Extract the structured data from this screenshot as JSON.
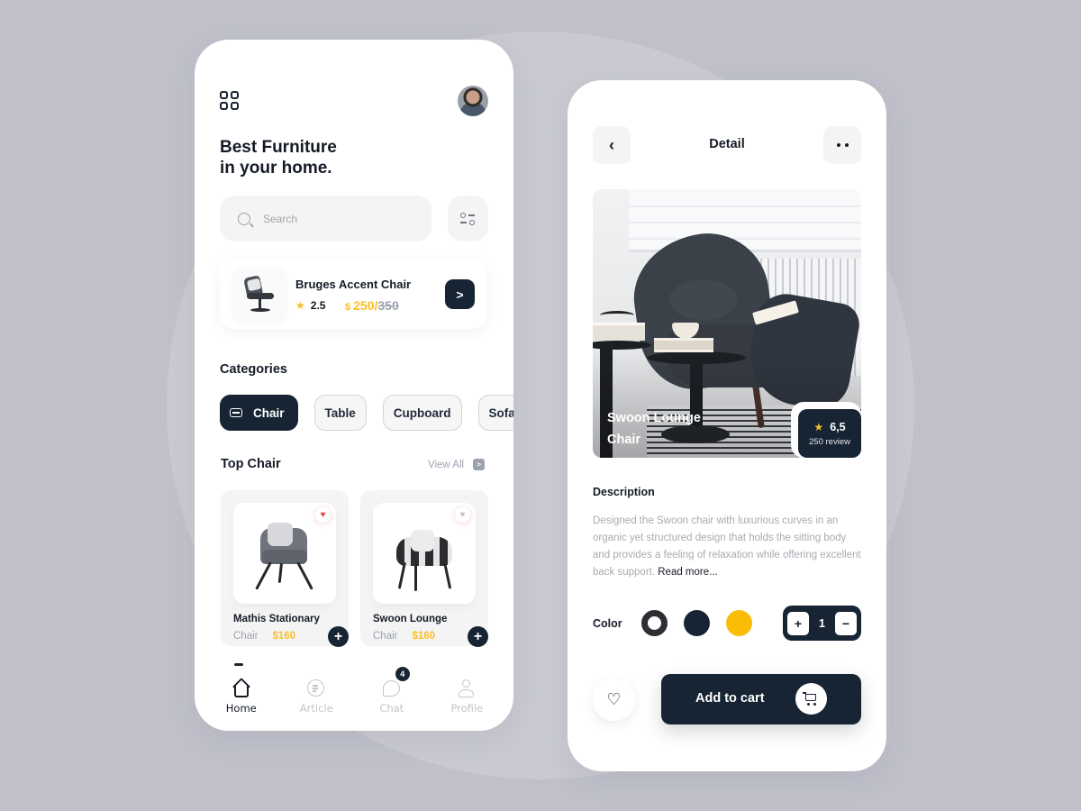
{
  "colors": {
    "primary": "#162434",
    "accent": "#fbbf24",
    "background": "#bfc0ca",
    "favorite": "#ef4444"
  },
  "home": {
    "menu_icon": "grid-icon",
    "avatar_icon": "user-avatar",
    "headline_line1": "Best Furniture",
    "headline_line2": "in your home.",
    "search": {
      "placeholder": "Search",
      "icon": "search-icon"
    },
    "filter_icon": "sliders-icon",
    "featured": {
      "name": "Bruges Accent Chair",
      "rating": "2.5",
      "currency": "$",
      "price": "250/",
      "old_price": "350",
      "action_icon": "chevron-right-icon",
      "action_label": ">"
    },
    "categories_title": "Categories",
    "categories": [
      {
        "label": "Chair",
        "active": true,
        "icon": "sofa-icon"
      },
      {
        "label": "Table",
        "active": false
      },
      {
        "label": "Cupboard",
        "active": false
      },
      {
        "label": "Sofa",
        "active": false
      }
    ],
    "top_title": "Top Chair",
    "view_all": "View All",
    "view_all_icon": ">",
    "products": [
      {
        "name": "Mathis Stationary",
        "type": "Chair",
        "price": "$160",
        "favorite": true,
        "fav_glyph": "♥"
      },
      {
        "name": "Swoon Lounge",
        "type": "Chair",
        "price": "$160",
        "favorite": false,
        "fav_glyph": "♥"
      }
    ],
    "add_glyph": "+",
    "nav": [
      {
        "label": "Home",
        "active": true,
        "icon": "home-icon"
      },
      {
        "label": "Article",
        "active": false,
        "icon": "article-icon"
      },
      {
        "label": "Chat",
        "active": false,
        "icon": "chat-icon",
        "badge": "4"
      },
      {
        "label": "Profile",
        "active": false,
        "icon": "profile-icon"
      }
    ]
  },
  "detail": {
    "title": "Detail",
    "back_glyph": "‹",
    "product_name": "Swoon Lounge Chair",
    "rating": "6,5",
    "reviews": "250 review",
    "description_title": "Description",
    "description": "Designed the Swoon chair with luxurious curves in an organic yet structured design that holds the sitting body and provides a feeling of relaxation while offering excellent back support.",
    "read_more": "Read more...",
    "color_label": "Color",
    "colors": [
      {
        "name": "white",
        "hex": "#ffffff",
        "selected": true
      },
      {
        "name": "navy",
        "hex": "#162434",
        "selected": false
      },
      {
        "name": "yellow",
        "hex": "#fbbc05",
        "selected": false
      }
    ],
    "quantity": "1",
    "plus": "+",
    "minus": "−",
    "heart_glyph": "♡",
    "add_to_cart": "Add to cart"
  }
}
